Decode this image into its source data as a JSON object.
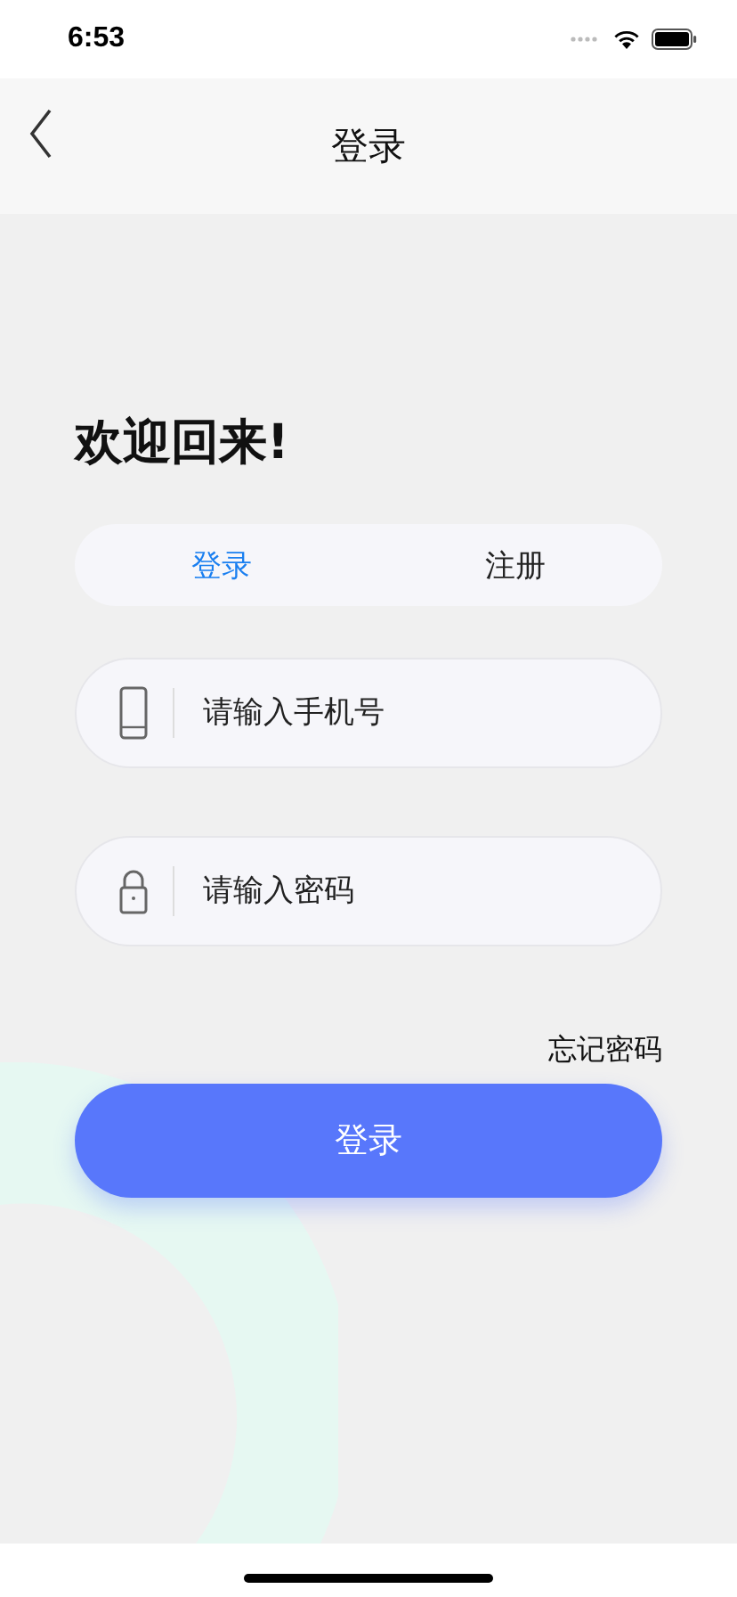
{
  "status_bar": {
    "time": "6:53"
  },
  "nav_bar": {
    "title": "登录"
  },
  "heading": "欢迎回来!",
  "tabs": [
    {
      "label": "登录",
      "selected": true
    },
    {
      "label": "注册",
      "selected": false
    }
  ],
  "fields": [
    {
      "kind": "phone",
      "placeholder": "请输入手机号"
    },
    {
      "kind": "password",
      "placeholder": "请输入密码"
    }
  ],
  "forgot_link": "忘记密码",
  "submit_button": "登录"
}
